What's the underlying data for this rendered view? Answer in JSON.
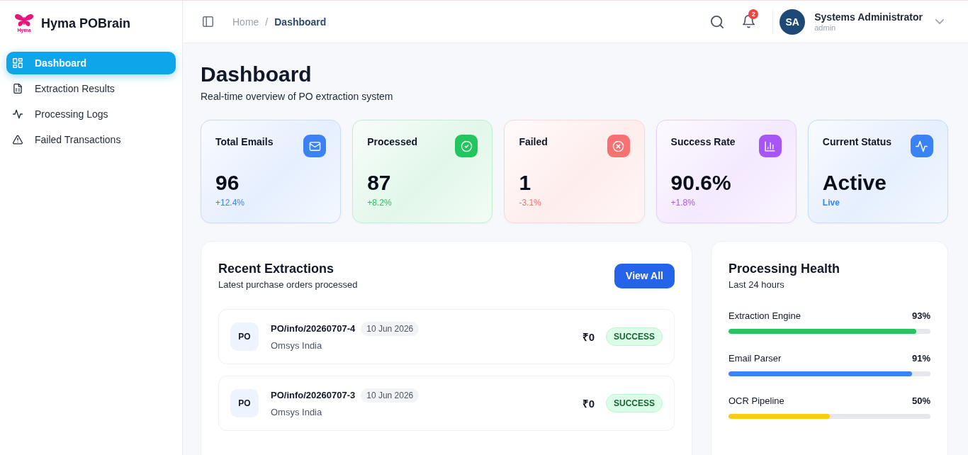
{
  "brand": {
    "logo_text": "Hyma",
    "name": "Hyma POBrain"
  },
  "sidebar": {
    "items": [
      {
        "label": "Dashboard",
        "kind": "dashboard",
        "selected": true
      },
      {
        "label": "Extraction Results",
        "kind": "results",
        "selected": false
      },
      {
        "label": "Processing Logs",
        "kind": "logs",
        "selected": false
      },
      {
        "label": "Failed Transactions",
        "kind": "failures",
        "selected": false
      }
    ]
  },
  "header": {
    "breadcrumb": [
      {
        "label": "Home",
        "current": false
      },
      {
        "label": "Dashboard",
        "current": true
      }
    ],
    "separator": "/",
    "notification_count": "2",
    "user": {
      "initials": "SA",
      "name": "Systems Administrator",
      "role": "admin"
    }
  },
  "page": {
    "title": "Dashboard",
    "subtitle": "Real-time overview of PO extraction system"
  },
  "stats": [
    {
      "kind": "emails",
      "label": "Total Emails",
      "value": "96",
      "change": "+12.4%",
      "color": "#3b82f6"
    },
    {
      "kind": "processed",
      "label": "Processed",
      "value": "87",
      "change": "+8.2%",
      "color": "#22c55e"
    },
    {
      "kind": "failed",
      "label": "Failed",
      "value": "1",
      "change": "-3.1%",
      "color": "#f87171"
    },
    {
      "kind": "rate",
      "label": "Success Rate",
      "value": "90.6%",
      "change": "+1.8%",
      "color": "#a855f7"
    },
    {
      "kind": "status",
      "label": "Current Status",
      "value": "Active",
      "change": "Live",
      "color": "#3b82f6"
    }
  ],
  "recent": {
    "title": "Recent Extractions",
    "subtitle": "Latest purchase orders processed",
    "button": "View All",
    "rows": [
      {
        "badge": "PO",
        "number": "PO/info/20260707-4",
        "date": "10 Jun 2026",
        "company": "Omsys India",
        "amount": "₹0",
        "status": "SUCCESS"
      },
      {
        "badge": "PO",
        "number": "PO/info/20260707-3",
        "date": "10 Jun 2026",
        "company": "Omsys India",
        "amount": "₹0",
        "status": "SUCCESS"
      }
    ]
  },
  "health": {
    "title": "Processing Health",
    "subtitle": "Last 24 hours",
    "items": [
      {
        "label": "Extraction Engine",
        "reading": "93%",
        "level": 0.93,
        "color": "#22c55e"
      },
      {
        "label": "Email Parser",
        "reading": "91%",
        "level": 0.91,
        "color": "#3b82f6"
      },
      {
        "label": "OCR Pipeline",
        "reading": "50%",
        "level": 0.5,
        "color": "#facc15"
      }
    ]
  }
}
